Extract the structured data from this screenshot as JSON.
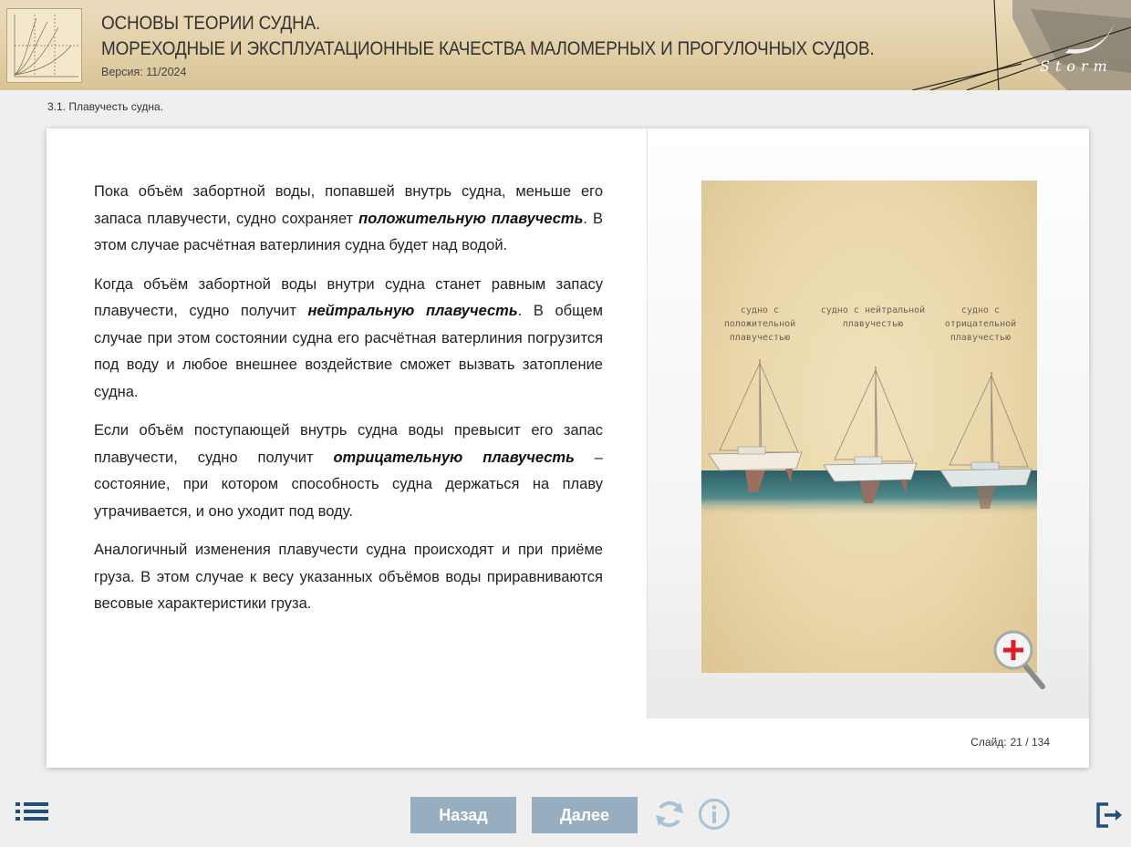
{
  "header": {
    "title_line1": "ОСНОВЫ ТЕОРИИ СУДНА.",
    "title_line2": "МОРЕХОДНЫЕ И ЭКСПЛУАТАЦИОННЫЕ КАЧЕСТВА МАЛОМЕРНЫХ И ПРОГУЛОЧНЫХ СУДОВ.",
    "version": "Версия: 11/2024",
    "brand": "Storm"
  },
  "breadcrumb": "3.1. Плавучесть судна.",
  "content": {
    "p1_before": "Пока объём забортной воды, попавшей внутрь судна, меньше его запаса плавучести, судно сохраняет ",
    "p1_emph": "положительную плавучесть",
    "p1_after": ". В этом случае расчётная ватерлиния судна будет над водой.",
    "p2_before": "Когда объём забортной воды внутри судна станет равным запасу плавучести, судно получит ",
    "p2_emph": "нейтральную плавучесть",
    "p2_after": ". В общем случае при этом состоянии судна его расчётная ватерлиния погрузится под воду и любое внешнее воздействие сможет вызвать затопление судна.",
    "p3_before": "Если объём поступающей внутрь судна воды превысит его запас плавучести, судно получит ",
    "p3_emph": "отрицательную плавучесть",
    "p3_after": " – состояние, при котором способность судна держаться на плаву утрачивается, и оно уходит под воду.",
    "p4": "Аналогичный изменения плавучести судна происходят и при приёме груза. В этом случае к весу указанных объёмов воды приравниваются весовые характеристики груза."
  },
  "illustration": {
    "captions": [
      "судно с положительной плавучестью",
      "судно с нейтральной плавучестью",
      "судно с отрицательной плавучестью"
    ]
  },
  "slide_counter": {
    "label": "Слайд:",
    "value": "21 / 134"
  },
  "footer": {
    "back_label": "Назад",
    "next_label": "Далее"
  },
  "colors": {
    "button_bg": "#97aec0",
    "icon_blue": "#234e7a",
    "icon_light": "#a9c3d4",
    "zoom_plus": "#d9202a"
  },
  "icons": [
    "menu-icon",
    "reload-icon",
    "info-icon",
    "exit-icon",
    "zoom-in-icon"
  ]
}
